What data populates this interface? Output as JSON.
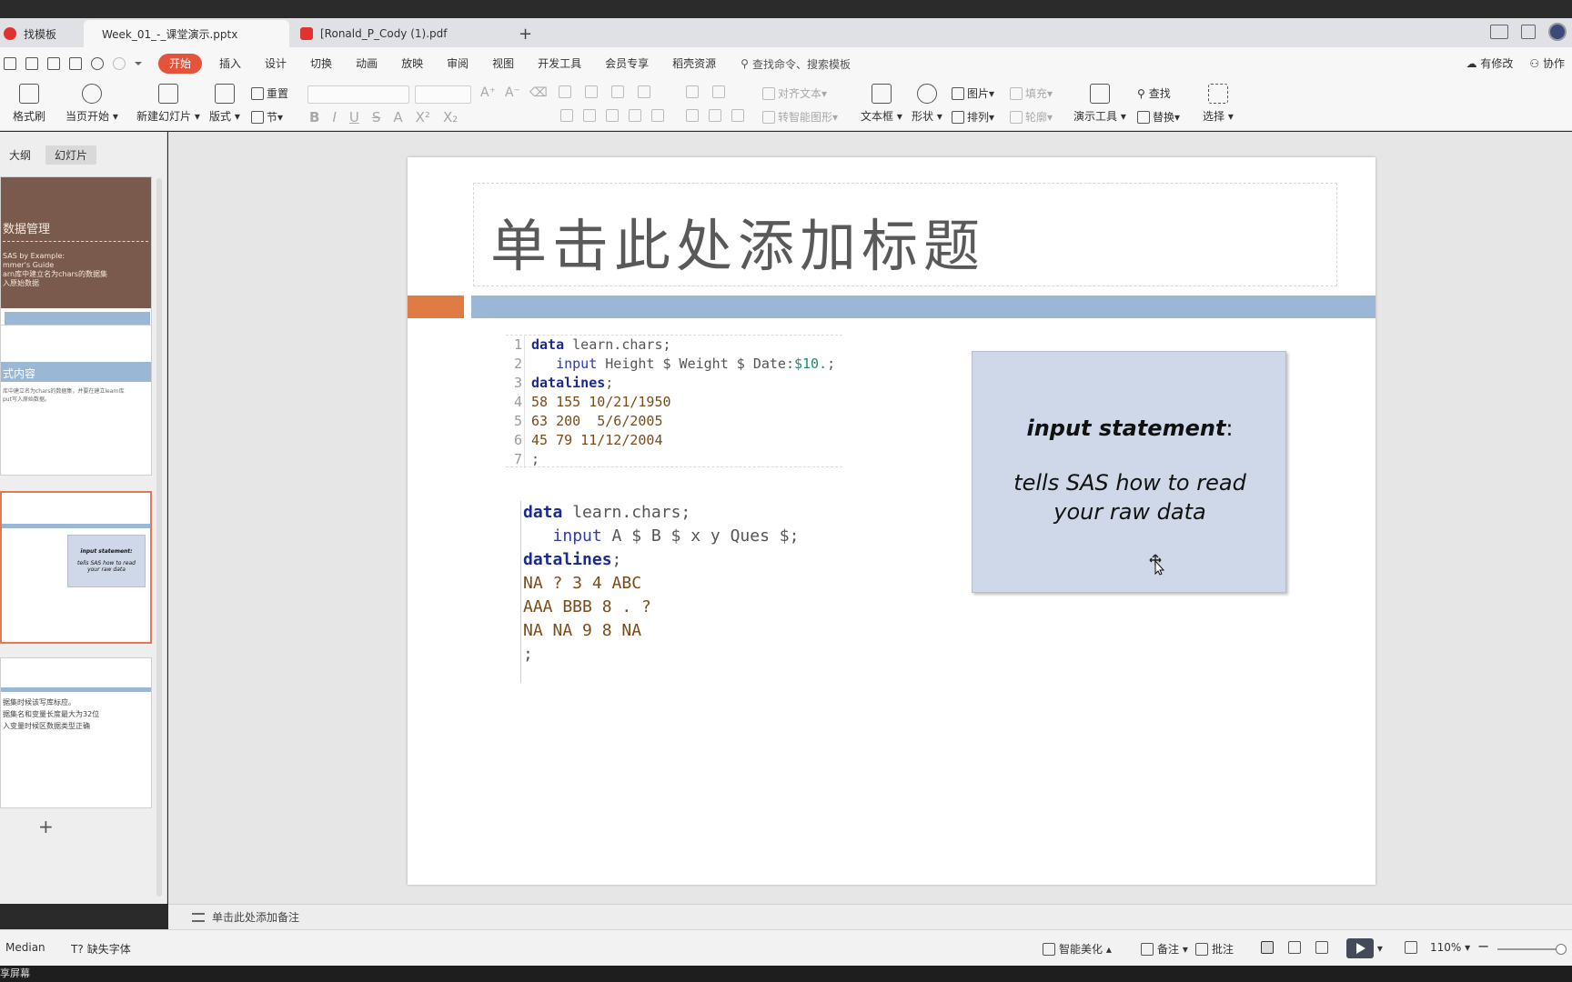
{
  "tabs": [
    {
      "label": "找模板",
      "color": "#e0322e"
    },
    {
      "label": "Week_01_-_课堂演示.pptx",
      "color": "#e5533a"
    },
    {
      "label": "[Ronald_P_Cody (1).pdf",
      "color": "#e0322e"
    }
  ],
  "menu": {
    "items": [
      "开始",
      "插入",
      "设计",
      "切换",
      "动画",
      "放映",
      "审阅",
      "视图",
      "开发工具",
      "会员专享",
      "稻壳资源"
    ],
    "search": "查找命令、搜索模板",
    "right": [
      "有修改",
      "协作"
    ]
  },
  "ribbon": {
    "format_painter": "格式刷",
    "play_from_current": "当页开始",
    "new_slide": "新建幻灯片",
    "layout": "版式",
    "reset": "重置",
    "section": "节",
    "align_text": "对齐文本",
    "smart_art": "转智能图形",
    "textbox": "文本框",
    "shape": "形状",
    "picture": "图片",
    "arrange": "排列",
    "fill": "填充",
    "outline": "轮廓",
    "presenter": "演示工具",
    "find": "查找",
    "replace": "替换",
    "select": "选择"
  },
  "left_panel": {
    "tabs": [
      "大纲",
      "幻灯片"
    ],
    "thumb1": {
      "title": "数据管理",
      "lines": [
        "SAS by Example:",
        "mmer's Guide",
        "arn库中建立名为chars的数据集",
        "入原始数据"
      ]
    },
    "thumb2": {
      "title": "式内容",
      "lines": [
        "库中建立名为chars的数据集，并要在建立learn库",
        "put写入原始数据。"
      ]
    },
    "thumb3": {
      "box_title": "input statement:",
      "box_body": "tells SAS how to read your raw data"
    },
    "thumb4": {
      "lines": [
        "据集时候该写库标应。",
        "据集名和变量长度最大为32位",
        "入变量时候区数据类型正确"
      ]
    }
  },
  "slide": {
    "title": "单击此处添加标题",
    "code1": [
      {
        "n": "1",
        "parts": [
          [
            "kw",
            "data"
          ],
          [
            "ob",
            " learn.chars;"
          ]
        ]
      },
      {
        "n": "2",
        "parts": [
          [
            "ob",
            "   "
          ],
          [
            "ip",
            "input"
          ],
          [
            "ob",
            " Height $ Weight $ Date:"
          ],
          [
            "fmt",
            "$10."
          ],
          [
            "ob",
            ";"
          ]
        ]
      },
      {
        "n": "3",
        "parts": [
          [
            "kw",
            "datalines"
          ],
          [
            "ob",
            ";"
          ]
        ]
      },
      {
        "n": "4",
        "parts": [
          [
            "dat",
            "58 155 10/21/1950"
          ]
        ]
      },
      {
        "n": "5",
        "parts": [
          [
            "dat",
            "63 200  5/6/2005"
          ]
        ]
      },
      {
        "n": "6",
        "parts": [
          [
            "dat",
            "45 79 11/12/2004"
          ]
        ]
      },
      {
        "n": "7",
        "parts": [
          [
            "ob",
            ";"
          ]
        ]
      }
    ],
    "code2": [
      [
        [
          "kw",
          "data"
        ],
        [
          "ob",
          " learn.chars;"
        ]
      ],
      [
        [
          "ob",
          "   "
        ],
        [
          "ip",
          "input"
        ],
        [
          "ob",
          " A $ B $ x y Ques $;"
        ]
      ],
      [
        [
          "kw",
          "datalines"
        ],
        [
          "ob",
          ";"
        ]
      ],
      [
        [
          "dat",
          "NA ? 3 4 ABC"
        ]
      ],
      [
        [
          "dat",
          "AAA BBB 8 . ?"
        ]
      ],
      [
        [
          "dat",
          "NA NA 9 8 NA"
        ]
      ],
      [
        [
          "ob",
          ";"
        ]
      ]
    ],
    "note_title": "input statement",
    "note_colon": ":",
    "note_body": "tells SAS how to read your raw data"
  },
  "notes_placeholder": "单击此处添加备注",
  "status": {
    "left1": "Median",
    "left2": "缺失字体",
    "beautify": "智能美化",
    "notes": "备注",
    "comment": "批注",
    "zoom": "110%"
  },
  "bottom_text": "享屏幕",
  "colors": {
    "accent": "#e5533a",
    "band_orange": "#e07b44",
    "band_blue": "#9ab7d6",
    "note_bg": "#cfd8e8"
  }
}
